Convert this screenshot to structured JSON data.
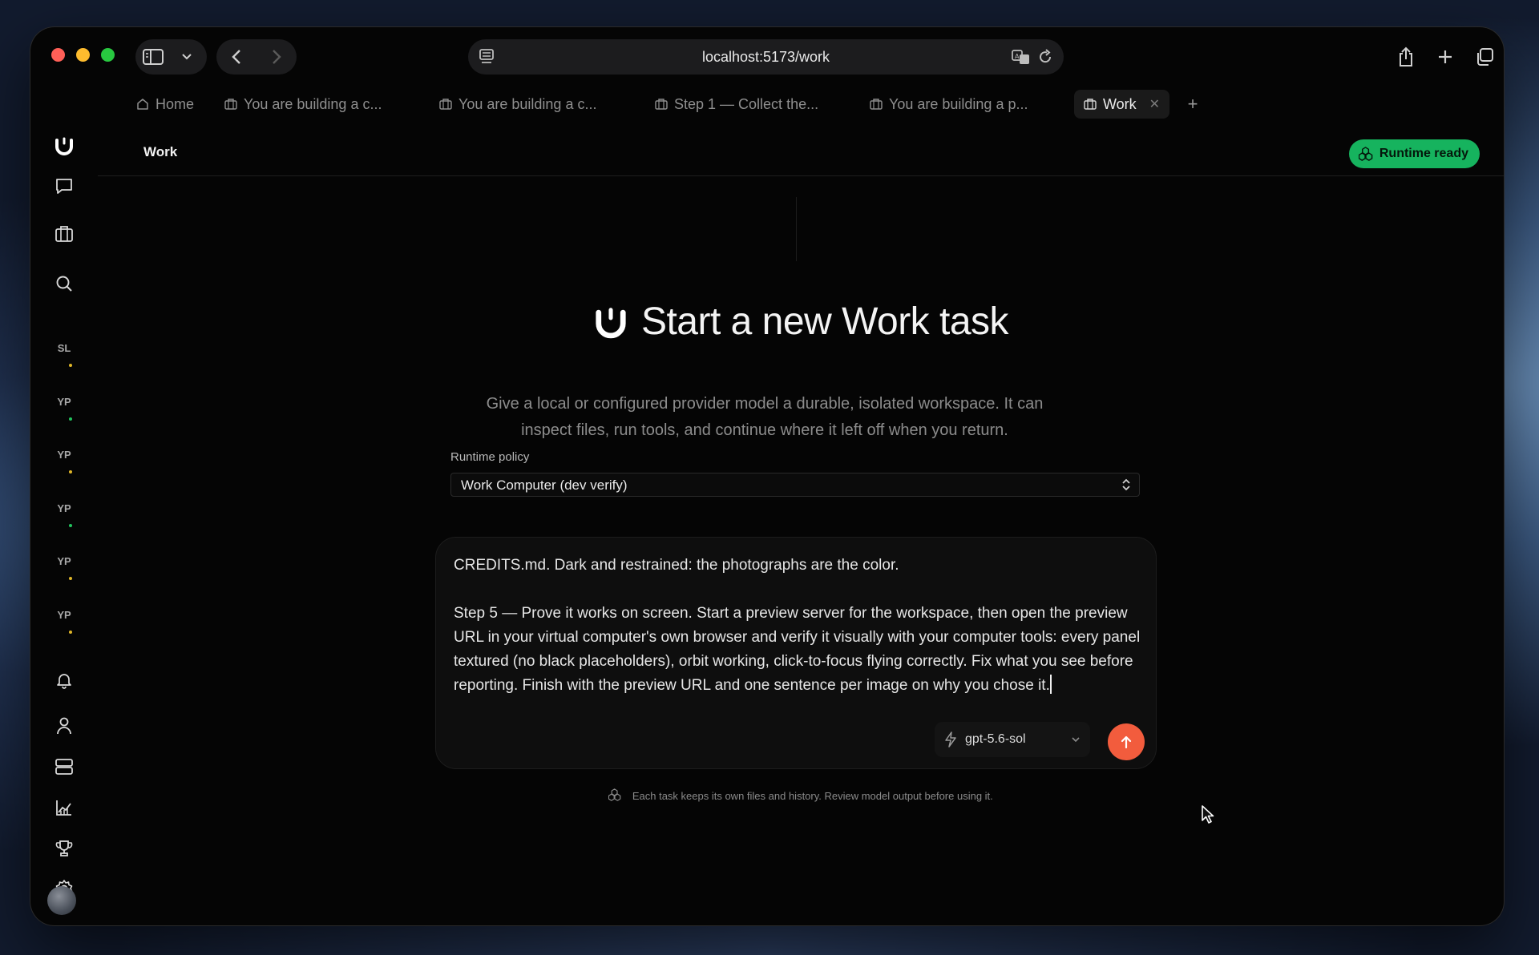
{
  "browser": {
    "url": "localhost:5173/work"
  },
  "tabs": [
    {
      "label": "Home",
      "icon": "home-icon"
    },
    {
      "label": "You are building a c...",
      "icon": "briefcase-icon"
    },
    {
      "label": "You are building a c...",
      "icon": "briefcase-icon"
    },
    {
      "label": "Step 1 — Collect the...",
      "icon": "briefcase-icon"
    },
    {
      "label": "You are building a p...",
      "icon": "briefcase-icon"
    },
    {
      "label": "Work",
      "icon": "briefcase-icon",
      "active": true
    }
  ],
  "rail": {
    "avatars": [
      {
        "initials": "SL",
        "dot_color": "#e0b628"
      },
      {
        "initials": "YP",
        "dot_color": "#22c55e"
      },
      {
        "initials": "YP",
        "dot_color": "#e0b628"
      },
      {
        "initials": "YP",
        "dot_color": "#22c55e"
      },
      {
        "initials": "YP",
        "dot_color": "#e0b628"
      },
      {
        "initials": "YP",
        "dot_color": "#e0b628"
      }
    ]
  },
  "header": {
    "title": "Work",
    "status": "Runtime ready"
  },
  "hero": {
    "title": "Start a new Work task",
    "description": "Give a local or configured provider model a durable, isolated workspace. It can inspect files, run tools, and continue where it left off when you return."
  },
  "policy": {
    "label": "Runtime policy",
    "value": "Work Computer (dev verify)"
  },
  "composer": {
    "text": "CREDITS.md. Dark and restrained: the photographs are the color.\n\nStep 5 — Prove it works on screen. Start a preview server for the workspace, then open the preview URL in your virtual computer's own browser and verify it visually with your computer tools: every panel textured (no black placeholders), orbit working, click-to-focus flying correctly. Fix what you see before reporting. Finish with the preview URL and one sentence per image on why you chose it.",
    "model": "gpt-5.6-sol"
  },
  "footnote": "Each task keeps its own files and history. Review model output before using it.",
  "colors": {
    "accent_send": "#f25c3d",
    "status_green": "#16b35e"
  }
}
